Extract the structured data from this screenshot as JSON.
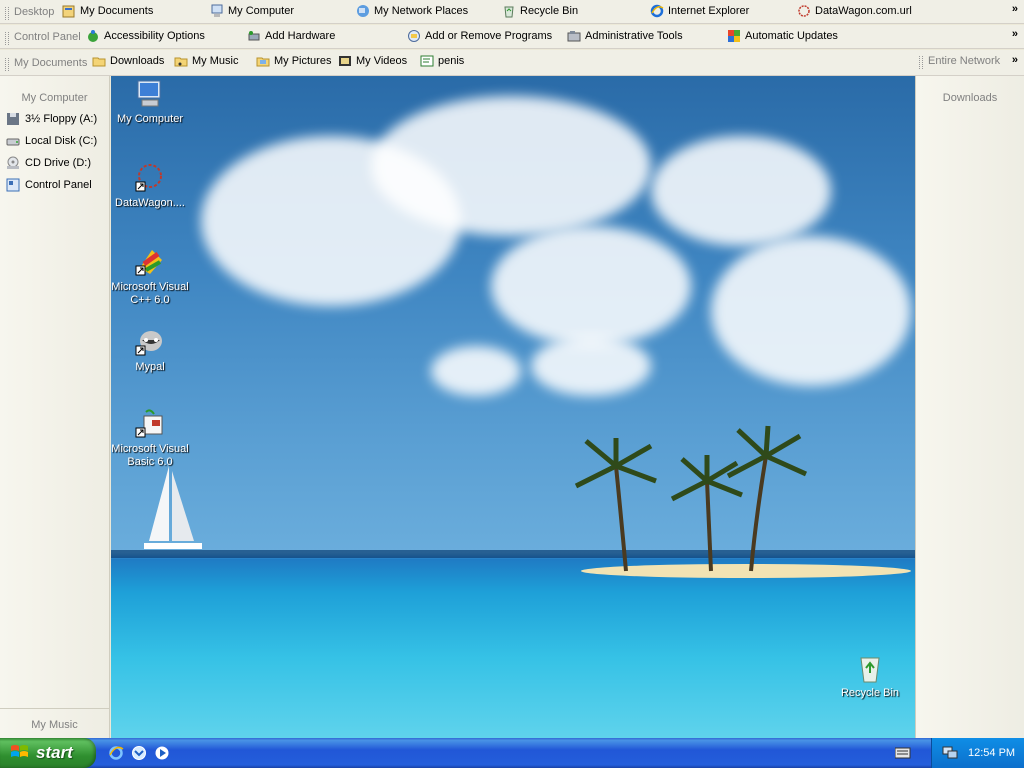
{
  "toolbars": {
    "row1": {
      "caption": "Desktop",
      "items": [
        {
          "label": "My Documents",
          "icon": "my-documents-icon"
        },
        {
          "label": "My Computer",
          "icon": "my-computer-icon"
        },
        {
          "label": "My Network Places",
          "icon": "network-places-icon"
        },
        {
          "label": "Recycle Bin",
          "icon": "recycle-bin-icon"
        },
        {
          "label": "Internet Explorer",
          "icon": "internet-explorer-icon"
        },
        {
          "label": "DataWagon.com.url",
          "icon": "url-shortcut-icon"
        }
      ],
      "more": "»"
    },
    "row2": {
      "caption": "Control Panel",
      "items": [
        {
          "label": "Accessibility Options",
          "icon": "accessibility-icon"
        },
        {
          "label": "Add Hardware",
          "icon": "add-hardware-icon"
        },
        {
          "label": "Add or Remove Programs",
          "icon": "add-remove-programs-icon"
        },
        {
          "label": "Administrative Tools",
          "icon": "admin-tools-icon"
        },
        {
          "label": "Automatic Updates",
          "icon": "automatic-updates-icon"
        }
      ],
      "more": "»"
    },
    "row3": {
      "caption": "My Documents",
      "items": [
        {
          "label": "Downloads",
          "icon": "folder-icon"
        },
        {
          "label": "My Music",
          "icon": "music-folder-icon"
        },
        {
          "label": "My Pictures",
          "icon": "pictures-folder-icon"
        },
        {
          "label": "My Videos",
          "icon": "videos-folder-icon"
        },
        {
          "label": "penis",
          "icon": "text-file-icon"
        }
      ],
      "right_caption": "Entire Network",
      "more": "»"
    }
  },
  "left_panel": {
    "title": "My Computer",
    "items": [
      {
        "label": "3½ Floppy (A:)",
        "icon": "floppy-drive-icon"
      },
      {
        "label": "Local Disk (C:)",
        "icon": "hard-disk-icon"
      },
      {
        "label": "CD Drive (D:)",
        "icon": "cd-drive-icon"
      },
      {
        "label": "Control Panel",
        "icon": "control-panel-icon"
      }
    ],
    "bottom": "My Music"
  },
  "right_panel": {
    "title": "Downloads"
  },
  "desktop_icons": [
    {
      "label": "My Computer",
      "icon": "my-computer-icon"
    },
    {
      "label": "DataWagon....",
      "icon": "url-shortcut-icon"
    },
    {
      "label": "Microsoft Visual C++ 6.0",
      "icon": "visual-cpp-icon"
    },
    {
      "label": "Mypal",
      "icon": "mypal-browser-icon"
    },
    {
      "label": "Microsoft Visual Basic 6.0",
      "icon": "visual-basic-icon"
    },
    {
      "label": "Recycle Bin",
      "icon": "recycle-bin-icon"
    }
  ],
  "taskbar": {
    "start_label": "start",
    "quick_launch": [
      "internet-explorer-icon",
      "outlook-express-icon",
      "media-player-icon"
    ],
    "clock": "12:54 PM"
  },
  "colors": {
    "taskbar_blue": "#245edb",
    "start_green": "#3c9a3c",
    "tray_blue": "#0f8ee6"
  }
}
